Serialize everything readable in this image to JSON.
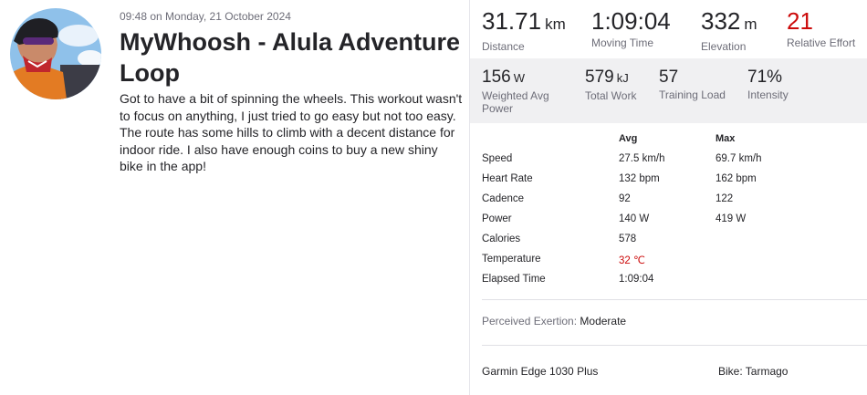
{
  "activity": {
    "timestamp": "09:48 on Monday, 21 October 2024",
    "title": "MyWhoosh - Alula Adventure Loop",
    "description": "Got to have a bit of spinning the wheels. This workout wasn't to focus on anything, I just tried to go easy but not too easy. The route has some hills to climb with a decent distance for indoor ride. I also have enough coins to buy a new shiny bike in the app!"
  },
  "primary_stats": [
    {
      "value": "31.71",
      "unit": "km",
      "label": "Distance"
    },
    {
      "value": "1:09:04",
      "unit": "",
      "label": "Moving Time"
    },
    {
      "value": "332",
      "unit": "m",
      "label": "Elevation"
    },
    {
      "value": "21",
      "unit": "",
      "label": "Relative Effort",
      "color": "#cc0b0b"
    }
  ],
  "secondary_stats": [
    {
      "value": "156",
      "unit": "W",
      "label": "Weighted Avg Power"
    },
    {
      "value": "579",
      "unit": "kJ",
      "label": "Total Work"
    },
    {
      "value": "57",
      "unit": "",
      "label": "Training Load"
    },
    {
      "value": "71%",
      "unit": "",
      "label": "Intensity"
    }
  ],
  "details": {
    "headers": {
      "avg": "Avg",
      "max": "Max"
    },
    "rows": [
      {
        "name": "Speed",
        "avg": "27.5 km/h",
        "max": "69.7 km/h"
      },
      {
        "name": "Heart Rate",
        "avg": "132 bpm",
        "max": "162 bpm"
      },
      {
        "name": "Cadence",
        "avg": "92",
        "max": "122"
      },
      {
        "name": "Power",
        "avg": "140 W",
        "max": "419 W"
      },
      {
        "name": "Calories",
        "avg": "578",
        "max": ""
      },
      {
        "name": "Temperature",
        "avg": "32 ℃",
        "max": ""
      },
      {
        "name": "Elapsed Time",
        "avg": "1:09:04",
        "max": ""
      }
    ]
  },
  "perceived_exertion": {
    "label": "Perceived Exertion:",
    "value": "Moderate"
  },
  "gear": {
    "device": "Garmin Edge 1030 Plus",
    "bike": "Bike: Tarmago"
  },
  "colors": {
    "accent_red": "#cc0b0b",
    "muted_text": "#6d6d78",
    "panel_bg": "#f0f0f2"
  }
}
